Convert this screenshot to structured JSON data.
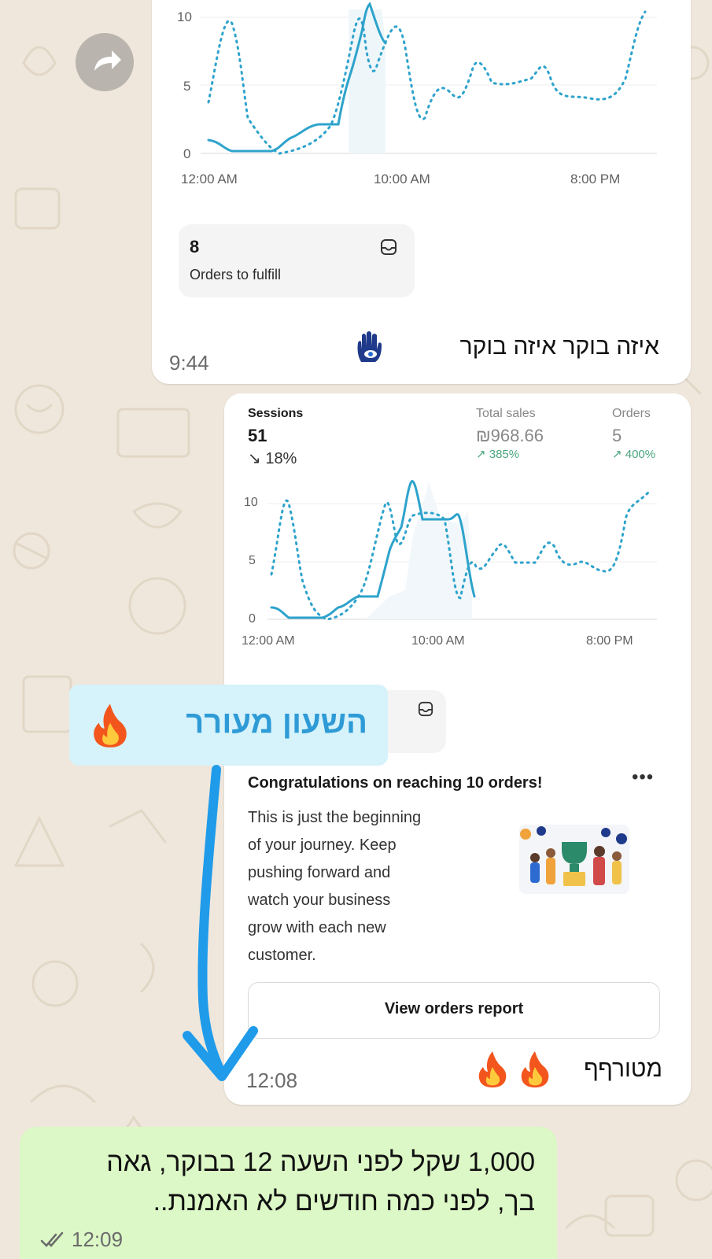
{
  "colors": {
    "wallpaper": "#efe7dc",
    "line_primary": "#2ea3cc",
    "outgoing_bubble": "#dcf8c6",
    "highlight_tag": "#d6f2fb",
    "highlight_text": "#2e9bd6",
    "arrow": "#1f9bea",
    "delta_up": "#4aa57d"
  },
  "forward_button": {
    "icon": "share-forward-icon"
  },
  "message1": {
    "chart": {
      "y_ticks": [
        "10",
        "5",
        "0"
      ],
      "x_ticks": [
        "12:00 AM",
        "10:00 AM",
        "8:00 PM"
      ]
    },
    "fulfill_card": {
      "count": "8",
      "label": "Orders to fulfill",
      "icon": "inbox-icon"
    },
    "caption": "איזה בוקר איזה בוקר",
    "emoji_icon": "hamsa-icon",
    "time": "9:44"
  },
  "message2": {
    "metrics": {
      "sessions": {
        "label": "Sessions",
        "value": "51",
        "delta": "↘ 18%"
      },
      "total_sales": {
        "label": "Total sales",
        "value": "₪968.66",
        "delta": "↗ 385%"
      },
      "orders": {
        "label": "Orders",
        "value": "5",
        "delta": "↗ 400%"
      }
    },
    "chart": {
      "y_ticks": [
        "10",
        "5",
        "0"
      ],
      "x_ticks": [
        "12:00 AM",
        "10:00 AM",
        "8:00 PM"
      ]
    },
    "card_icon": "inbox-icon",
    "congrats": {
      "title": "Congratulations on reaching 10 orders!",
      "more_icon": "more-horizontal-icon",
      "body_lines": [
        "This is just the beginning",
        "of your journey. Keep",
        "pushing forward and",
        "watch your business",
        "grow with each new",
        "customer."
      ],
      "illustration": "celebration-trophy-illustration",
      "button": "View orders report"
    },
    "caption": "מטורףף",
    "emoji_icons": [
      "fire-icon",
      "fire-icon"
    ],
    "time": "12:08"
  },
  "overlay": {
    "tag_text": "השעון מעורר",
    "tag_emoji": "fire-icon",
    "arrow": "arrow-down-icon"
  },
  "outgoing": {
    "lines": [
      "1,000 שקל לפני השעה 12 בבוקר, גאה",
      "בך, לפני כמה חודשים לא האמנת.."
    ],
    "status_icon": "double-check-icon",
    "time": "12:09"
  }
}
